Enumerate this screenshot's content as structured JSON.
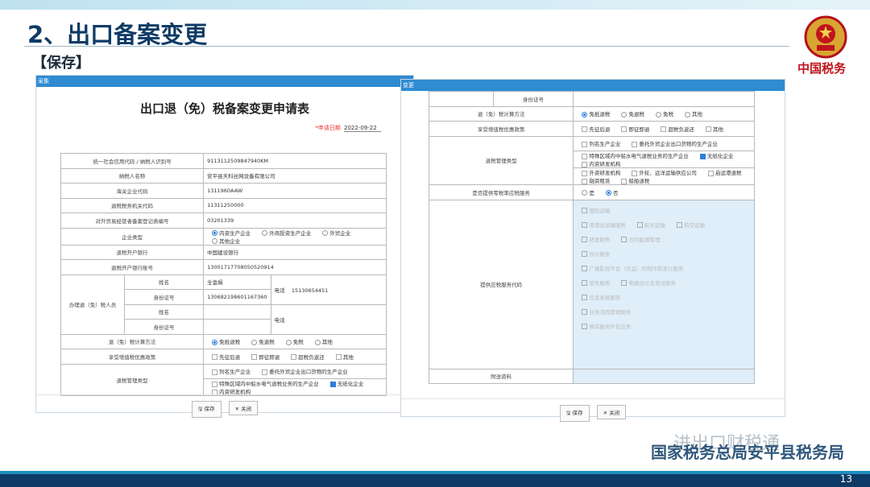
{
  "slide": {
    "title": "2、出口备案变更",
    "subtitle": "【保存】",
    "emblem_text": "中国税务",
    "watermark": "进出口财税通",
    "footer_org": "国家税务总局安平县税务局",
    "page_number": "13"
  },
  "left_window": {
    "header": "采集",
    "form_title": "出口退（免）税备案变更申请表",
    "date_label": "*申请日期",
    "date_value": "2022-09-22",
    "rows": [
      {
        "label": "统一社会信用代码 / 纳税人识别号",
        "value": "91131125098479​40KM"
      },
      {
        "label": "纳税人名称",
        "value": "安平县天科丝网设备有限公司"
      },
      {
        "label": "海关企业代码",
        "value": "1311960AAW"
      },
      {
        "label": "退税税务机关代码",
        "value": "11311250000"
      },
      {
        "label": "对外贸易经营者备案登记表编号",
        "value": "03201339"
      }
    ],
    "enterprise_type": {
      "label": "企业类型",
      "options": [
        "内资生产企业",
        "外商投资生产企业",
        "外贸企业",
        "其他企业"
      ]
    },
    "bank": {
      "label": "退税开户银行",
      "value": "中国建设银行"
    },
    "account": {
      "label": "退税开户银行账号",
      "value": "13001717708050520914"
    },
    "agent": {
      "group_label": "办理退（免）税人员",
      "name_label": "姓名",
      "name_value": "全金娟",
      "id_label": "身份证号",
      "id_value": "130682198601167360",
      "phone_label": "电话",
      "phone_value": "15130654451",
      "name2_label": "姓名",
      "id2_label": "身份证号",
      "phone2_label": "电话"
    },
    "calc": {
      "label": "退（免）税计算方法",
      "options": [
        "免抵退税",
        "免退税",
        "免税",
        "其他"
      ]
    },
    "policy": {
      "label": "享受增值税优惠政策",
      "options": [
        "先征后退",
        "即征即退",
        "超税负返还",
        "其他"
      ]
    },
    "mgmt": {
      "label": "退税管理类型",
      "line1": [
        "列名生产企业",
        "委托外贸企业出口货物的生产企业"
      ],
      "line2": [
        "特殊区域内中船水电气退税业务的生产企业",
        "无纸化企业",
        "内资研发机构"
      ]
    },
    "buttons": {
      "save": "保存",
      "close": "关闭"
    }
  },
  "right_window": {
    "header": "变更",
    "id_label": "身份证号",
    "calc": {
      "label": "退（免）税计算方法",
      "options": [
        "免抵退税",
        "免退税",
        "免税",
        "其他"
      ]
    },
    "policy": {
      "label": "享受增值税优惠政策",
      "options": [
        "先征后退",
        "即征即退",
        "超税负返还",
        "其他"
      ]
    },
    "mgmt": {
      "label": "退税管理类型",
      "line1": [
        "列名生产企业",
        "委托外贸企业出口货物的生产企业"
      ],
      "line2": [
        "特殊区域内中船水电气退税业务的生产企业",
        "无纸化企业",
        "内资研发机构"
      ],
      "line3": [
        "外资研发机构",
        "外轮、远洋运输供应公司",
        "启运港退税",
        "融资租赁",
        "船舶退税"
      ]
    },
    "zero_rate": {
      "label": "是否提供零税率应税服务",
      "options": [
        "是",
        "否"
      ]
    },
    "service_code": {
      "label": "提供应税服务代码",
      "items": [
        "国际运输",
        "港澳台运输服务",
        "航天运输",
        "航空运输",
        "研发服务",
        "合同能源管理",
        "设计服务",
        "广播影视节目（作品）的制作和发行服务",
        "软件服务",
        "电路设计及测试服务",
        "信息系统服务",
        "业务流程管理服务",
        "离岸服务外包业务"
      ]
    },
    "attachments_label": "附送资料",
    "buttons": {
      "save": "保存",
      "close": "关闭"
    }
  }
}
